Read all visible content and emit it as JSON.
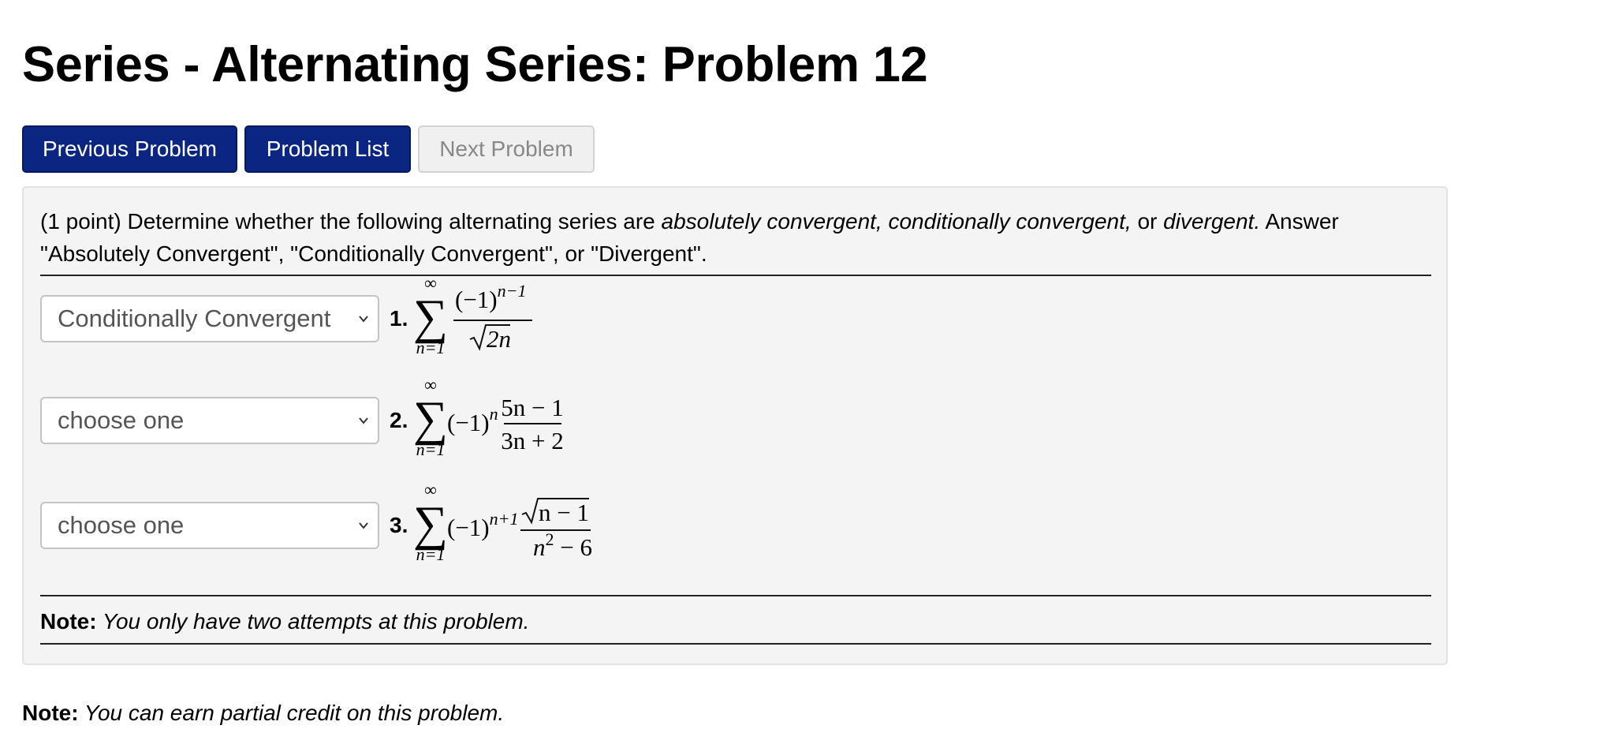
{
  "page": {
    "title": "Series - Alternating Series: Problem 12"
  },
  "nav": {
    "previous": "Previous Problem",
    "list": "Problem List",
    "next": "Next Problem"
  },
  "problem": {
    "intro_prefix": "(1 point) Determine whether the following alternating series are ",
    "intro_em1": "absolutely convergent, conditionally convergent,",
    "intro_mid": " or ",
    "intro_em2": "divergent.",
    "intro_suffix": " Answer \"Absolutely Convergent\", \"Conditionally Convergent\", or \"Divergent\".",
    "items": [
      {
        "number": "1.",
        "selected": "Conditionally Convergent",
        "sum_upper": "∞",
        "sum_lower": "n=1",
        "numerator": "(−1)",
        "numerator_exp": "n−1",
        "denominator": "2n"
      },
      {
        "number": "2.",
        "selected": "choose one",
        "sum_upper": "∞",
        "sum_lower": "n=1",
        "factor": "(−1)",
        "factor_exp": "n",
        "numerator": "5n − 1",
        "denominator": "3n + 2"
      },
      {
        "number": "3.",
        "selected": "choose one",
        "sum_upper": "∞",
        "sum_lower": "n=1",
        "factor": "(−1)",
        "factor_exp": "n+1",
        "numerator": "n − 1",
        "denominator_base": "n",
        "denominator_exp": "2",
        "denominator_rest": " − 6"
      }
    ],
    "note_label": "Note:",
    "note_text": " You only have two attempts at this problem."
  },
  "footer_note": {
    "label": "Note:",
    "text": " You can earn partial credit on this problem."
  },
  "colors": {
    "primary_button": "#0b2583",
    "panel_background": "#f4f4f4"
  }
}
